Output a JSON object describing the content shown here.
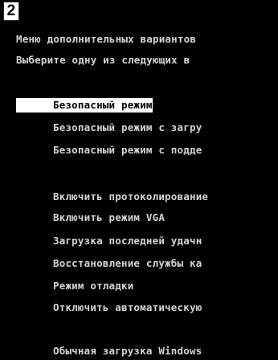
{
  "badge": {
    "number": "2"
  },
  "header": {
    "title": "Меню дополнительных вариантов",
    "subtitle": "Выберите одну из следующих в"
  },
  "menu": {
    "items": [
      {
        "label": "Безопасный режим"
      },
      {
        "label": "Безопасный режим с загру"
      },
      {
        "label": "Безопасный режим с подде"
      },
      {
        "label": "Включить протоколирование"
      },
      {
        "label": "Включить режим VGA"
      },
      {
        "label": "Загрузка последней удачн"
      },
      {
        "label": "Восстановление службы ка"
      },
      {
        "label": "Режим отладки"
      },
      {
        "label": "Отключить автоматическую"
      },
      {
        "label": "Обычная загрузка Windows"
      }
    ]
  },
  "colors": {
    "background": "#000000",
    "text": "#d4d4d4",
    "highlight_bg": "#ffffff",
    "highlight_text": "#000000"
  }
}
